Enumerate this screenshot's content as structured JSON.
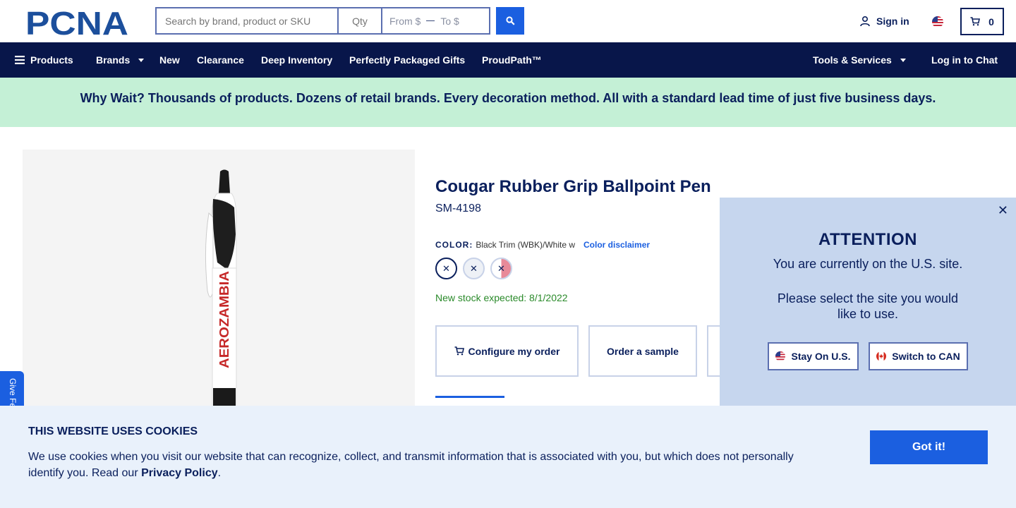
{
  "header": {
    "logo_text": "PCNA",
    "search_placeholder": "Search by brand, product or SKU",
    "qty_placeholder": "Qty",
    "price_from_placeholder": "From $",
    "price_to_placeholder": "To $",
    "sign_in_label": "Sign in",
    "cart_count": "0"
  },
  "nav": {
    "products": "Products",
    "brands": "Brands",
    "new": "New",
    "clearance": "Clearance",
    "deep_inventory": "Deep Inventory",
    "gifts": "Perfectly Packaged Gifts",
    "proudpath": "ProudPath™",
    "tools": "Tools & Services",
    "chat": "Log in to Chat"
  },
  "banner": {
    "text": "Why Wait? Thousands of products. Dozens of retail brands. Every decoration method. All with a standard lead time of just five business days."
  },
  "product": {
    "title": "Cougar Rubber Grip Ballpoint Pen",
    "sku": "SM-4198",
    "color_label": "COLOR:",
    "color_value": "Black Trim (WBK)/White w",
    "color_disclaimer": "Color disclaimer",
    "stock_text": "New stock expected: 8/1/2022",
    "image_brand_text": "AEROZAMBIA",
    "actions": {
      "configure": "Configure my order",
      "sample": "Order a sample"
    },
    "swatch_mark": "✕"
  },
  "feedback": {
    "label": "Give Fe"
  },
  "attention": {
    "close": "✕",
    "title": "ATTENTION",
    "message": "You are currently on the U.S. site.",
    "prompt": "Please select the site you would like to use.",
    "stay_label": "Stay On U.S.",
    "switch_label": "Switch to CAN"
  },
  "cookie": {
    "title": "THIS WEBSITE USES COOKIES",
    "text": "We use cookies when you visit our website that can recognize, collect, and transmit information that is associated with you, but which does not personally identify you. Read our ",
    "link": "Privacy Policy",
    "end": ".",
    "button": "Got it!"
  },
  "colors": {
    "navy": "#08164a",
    "accent_blue": "#1b5fe0",
    "banner_green": "#c4f0d6",
    "popup_bg": "#c6d6ee",
    "cookie_bg": "#e9f1fb",
    "stock_green": "#2a8a2a"
  }
}
